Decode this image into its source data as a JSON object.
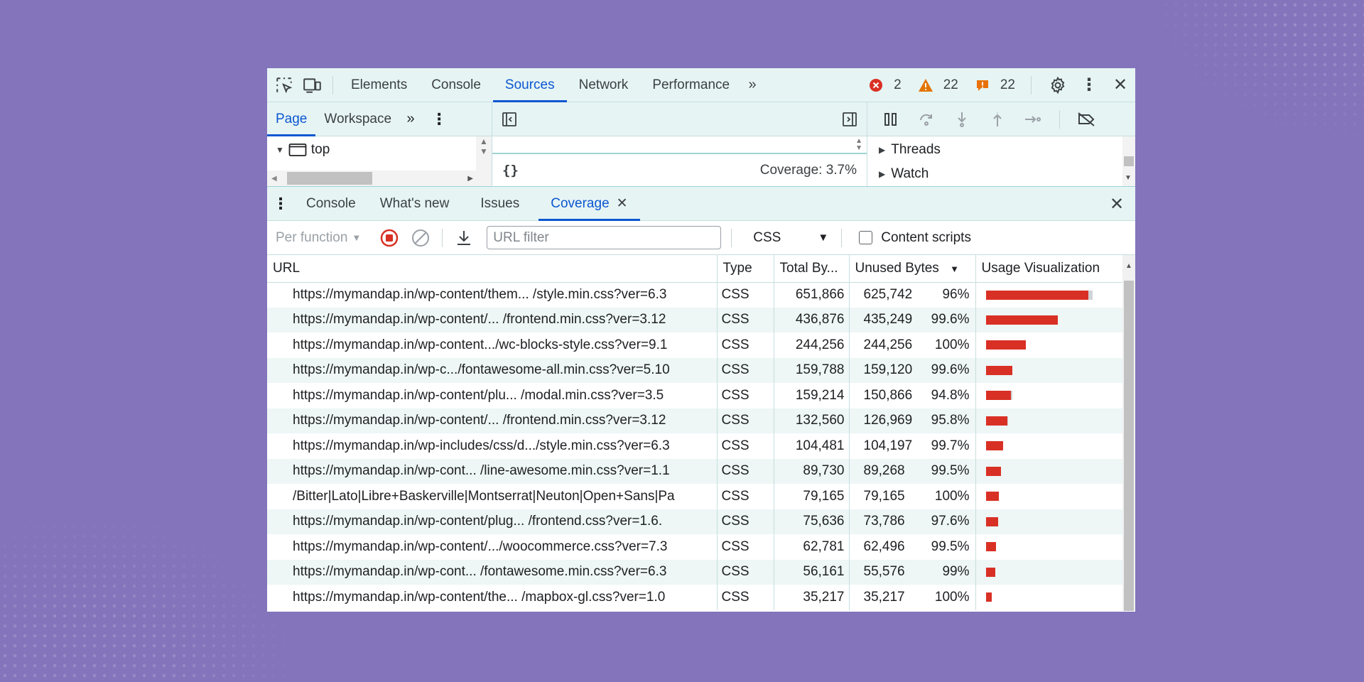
{
  "toolbar": {
    "tabs": [
      "Elements",
      "Console",
      "Sources",
      "Network",
      "Performance"
    ],
    "active_tab": "Sources",
    "errors": "2",
    "warnings": "22",
    "issues": "22"
  },
  "navigator": {
    "tabs": [
      "Page",
      "Workspace"
    ],
    "tree_item": "top"
  },
  "editor": {
    "status_brackets": "{}",
    "coverage_label": "Coverage: 3.7%"
  },
  "debugger": {
    "panes": [
      "Threads",
      "Watch"
    ]
  },
  "drawer": {
    "tabs": [
      "Console",
      "What's new",
      "Issues",
      "Coverage"
    ],
    "active_tab": "Coverage"
  },
  "coverage_toolbar": {
    "granularity": "Per function",
    "url_filter_placeholder": "URL filter",
    "type_filter": "CSS",
    "content_scripts_label": "Content scripts"
  },
  "table": {
    "columns": [
      "URL",
      "Type",
      "Total By...",
      "Unused Bytes",
      "Usage Visualization"
    ],
    "rows": [
      {
        "url": "https://mymandap.in/wp-content/them... /style.min.css?ver=6.3",
        "type": "CSS",
        "total": "651,866",
        "unused": "625,742",
        "pct": "96%",
        "total_bytes": 651866,
        "unused_fraction": 0.96
      },
      {
        "url": "https://mymandap.in/wp-content/... /frontend.min.css?ver=3.12",
        "type": "CSS",
        "total": "436,876",
        "unused": "435,249",
        "pct": "99.6%",
        "total_bytes": 436876,
        "unused_fraction": 0.996
      },
      {
        "url": "https://mymandap.in/wp-content.../wc-blocks-style.css?ver=9.1",
        "type": "CSS",
        "total": "244,256",
        "unused": "244,256",
        "pct": "100%",
        "total_bytes": 244256,
        "unused_fraction": 1.0
      },
      {
        "url": "https://mymandap.in/wp-c.../fontawesome-all.min.css?ver=5.10",
        "type": "CSS",
        "total": "159,788",
        "unused": "159,120",
        "pct": "99.6%",
        "total_bytes": 159788,
        "unused_fraction": 0.996
      },
      {
        "url": "https://mymandap.in/wp-content/plu... /modal.min.css?ver=3.5",
        "type": "CSS",
        "total": "159,214",
        "unused": "150,866",
        "pct": "94.8%",
        "total_bytes": 159214,
        "unused_fraction": 0.948
      },
      {
        "url": "https://mymandap.in/wp-content/... /frontend.min.css?ver=3.12",
        "type": "CSS",
        "total": "132,560",
        "unused": "126,969",
        "pct": "95.8%",
        "total_bytes": 132560,
        "unused_fraction": 0.958
      },
      {
        "url": "https://mymandap.in/wp-includes/css/d.../style.min.css?ver=6.3",
        "type": "CSS",
        "total": "104,481",
        "unused": "104,197",
        "pct": "99.7%",
        "total_bytes": 104481,
        "unused_fraction": 0.997
      },
      {
        "url": "https://mymandap.in/wp-cont... /line-awesome.min.css?ver=1.1",
        "type": "CSS",
        "total": "89,730",
        "unused": "89,268",
        "pct": "99.5%",
        "total_bytes": 89730,
        "unused_fraction": 0.995
      },
      {
        "url": "/Bitter|Lato|Libre+Baskerville|Montserrat|Neuton|Open+Sans|Pa",
        "type": "CSS",
        "total": "79,165",
        "unused": "79,165",
        "pct": "100%",
        "total_bytes": 79165,
        "unused_fraction": 1.0
      },
      {
        "url": "https://mymandap.in/wp-content/plug... /frontend.css?ver=1.6.",
        "type": "CSS",
        "total": "75,636",
        "unused": "73,786",
        "pct": "97.6%",
        "total_bytes": 75636,
        "unused_fraction": 0.976
      },
      {
        "url": "https://mymandap.in/wp-content/.../woocommerce.css?ver=7.3",
        "type": "CSS",
        "total": "62,781",
        "unused": "62,496",
        "pct": "99.5%",
        "total_bytes": 62781,
        "unused_fraction": 0.995
      },
      {
        "url": "https://mymandap.in/wp-cont... /fontawesome.min.css?ver=6.3",
        "type": "CSS",
        "total": "56,161",
        "unused": "55,576",
        "pct": "99%",
        "total_bytes": 56161,
        "unused_fraction": 0.99
      },
      {
        "url": "https://mymandap.in/wp-content/the... /mapbox-gl.css?ver=1.0",
        "type": "CSS",
        "total": "35,217",
        "unused": "35,217",
        "pct": "100%",
        "total_bytes": 35217,
        "unused_fraction": 1.0
      }
    ]
  },
  "colors": {
    "background": "#8474bc",
    "accent": "#0b57d0",
    "unused_bar": "#d93025",
    "used_bar": "#d0d4d7",
    "error": "#d93025",
    "warning": "#e37400"
  },
  "icons": [
    "inspect-element-icon",
    "device-toolbar-icon",
    "more-tabs-icon",
    "error-icon",
    "warning-icon",
    "issue-icon",
    "settings-gear-icon",
    "kebab-menu-icon",
    "close-icon",
    "toggle-navigator-icon",
    "toggle-debugger-icon",
    "pause-icon",
    "step-over-icon",
    "step-into-icon",
    "step-out-icon",
    "step-icon",
    "deactivate-breakpoints-icon",
    "record-stop-icon",
    "clear-icon",
    "export-icon",
    "checkbox-icon"
  ]
}
